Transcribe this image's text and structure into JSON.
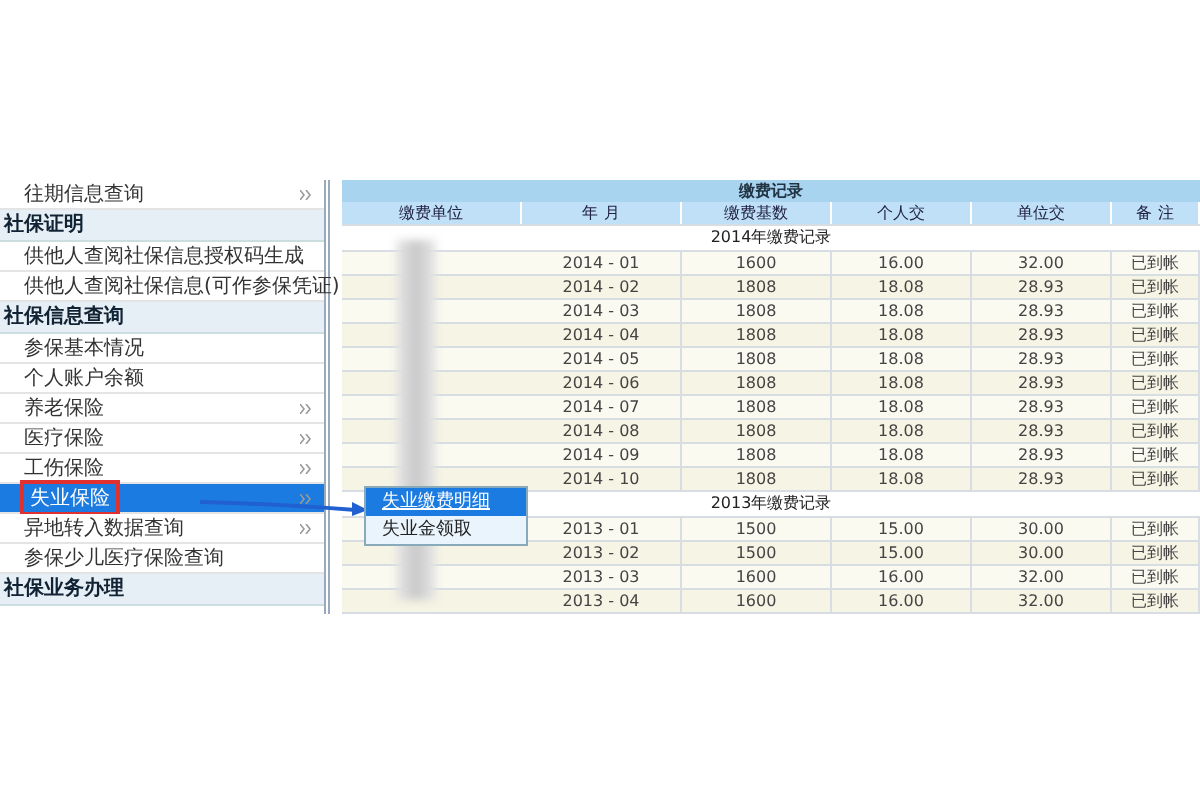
{
  "sidebar": {
    "items": [
      {
        "kind": "item",
        "label": "往期信息查询",
        "submenu": true,
        "selected": false
      },
      {
        "kind": "header",
        "label": "社保证明"
      },
      {
        "kind": "item",
        "label": "供他人查阅社保信息授权码生成",
        "submenu": false,
        "selected": false
      },
      {
        "kind": "item",
        "label": "供他人查阅社保信息(可作参保凭证)",
        "submenu": false,
        "selected": false
      },
      {
        "kind": "header",
        "label": "社保信息查询"
      },
      {
        "kind": "item",
        "label": "参保基本情况",
        "submenu": false,
        "selected": false
      },
      {
        "kind": "item",
        "label": "个人账户余额",
        "submenu": false,
        "selected": false
      },
      {
        "kind": "item",
        "label": "养老保险",
        "submenu": true,
        "selected": false
      },
      {
        "kind": "item",
        "label": "医疗保险",
        "submenu": true,
        "selected": false
      },
      {
        "kind": "item",
        "label": "工伤保险",
        "submenu": true,
        "selected": false
      },
      {
        "kind": "item",
        "label": "失业保险",
        "submenu": true,
        "selected": true
      },
      {
        "kind": "item",
        "label": "异地转入数据查询",
        "submenu": true,
        "selected": false
      },
      {
        "kind": "item",
        "label": "参保少儿医疗保险查询",
        "submenu": false,
        "selected": false
      },
      {
        "kind": "header",
        "label": "社保业务办理"
      }
    ]
  },
  "popup_menu": {
    "items": [
      {
        "label": "失业缴费明细",
        "selected": true
      },
      {
        "label": "失业金领取",
        "selected": false
      }
    ]
  },
  "table": {
    "title": "缴费记录",
    "columns": [
      "缴费单位",
      "年 月",
      "缴费基数",
      "个人交",
      "单位交",
      "备 注"
    ],
    "groups": [
      {
        "label": "2014年缴费记录",
        "rows": [
          [
            "2014 - 01",
            "1600",
            "16.00",
            "32.00",
            "已到帐"
          ],
          [
            "2014 - 02",
            "1808",
            "18.08",
            "28.93",
            "已到帐"
          ],
          [
            "2014 - 03",
            "1808",
            "18.08",
            "28.93",
            "已到帐"
          ],
          [
            "2014 - 04",
            "1808",
            "18.08",
            "28.93",
            "已到帐"
          ],
          [
            "2014 - 05",
            "1808",
            "18.08",
            "28.93",
            "已到帐"
          ],
          [
            "2014 - 06",
            "1808",
            "18.08",
            "28.93",
            "已到帐"
          ],
          [
            "2014 - 07",
            "1808",
            "18.08",
            "28.93",
            "已到帐"
          ],
          [
            "2014 - 08",
            "1808",
            "18.08",
            "28.93",
            "已到帐"
          ],
          [
            "2014 - 09",
            "1808",
            "18.08",
            "28.93",
            "已到帐"
          ],
          [
            "2014 - 10",
            "1808",
            "18.08",
            "28.93",
            "已到帐"
          ]
        ]
      },
      {
        "label": "2013年缴费记录",
        "rows": [
          [
            "2013 - 01",
            "1500",
            "15.00",
            "30.00",
            "已到帐"
          ],
          [
            "2013 - 02",
            "1500",
            "15.00",
            "30.00",
            "已到帐"
          ],
          [
            "2013 - 03",
            "1600",
            "16.00",
            "32.00",
            "已到帐"
          ],
          [
            "2013 - 04",
            "1600",
            "16.00",
            "32.00",
            "已到帐"
          ]
        ]
      }
    ]
  }
}
